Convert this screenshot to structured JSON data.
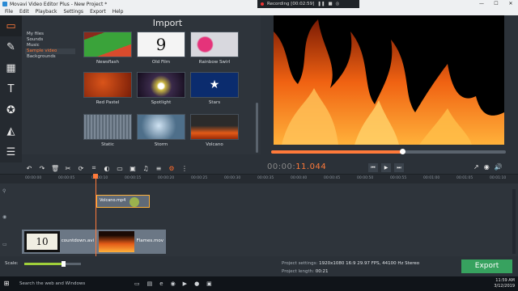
{
  "window": {
    "title": "Movavi Video Editor Plus - New Project *",
    "recording_text": "Recording [00:02:59]",
    "controls": [
      "—",
      "☐",
      "✕"
    ]
  },
  "menu": [
    "File",
    "Edit",
    "Playback",
    "Settings",
    "Export",
    "Help"
  ],
  "import": {
    "title": "Import",
    "categories": [
      "My files",
      "Sounds",
      "Music",
      "Sample video",
      "Backgrounds"
    ],
    "active_category": "Sample video",
    "tiles": [
      {
        "label": "Newsflash",
        "color": "#2f8a32"
      },
      {
        "label": "Old Film",
        "color": "#f3f3f3"
      },
      {
        "label": "Rainbow Swirl",
        "color": "#d8d8de"
      },
      {
        "label": "Red Pastel",
        "color": "#b23b12"
      },
      {
        "label": "Spotlight",
        "color": "#2a1a3a"
      },
      {
        "label": "Stars",
        "color": "#0b2c6e"
      },
      {
        "label": "Static",
        "color": "#6c7a8a"
      },
      {
        "label": "Storm",
        "color": "#4e6f8a"
      },
      {
        "label": "Volcano",
        "color": "#2b2b2b"
      }
    ]
  },
  "preview": {
    "timecode_dim": "00:00:",
    "timecode_hl": "11.044",
    "progress": 0.56
  },
  "timeline": {
    "ticks": [
      "00:00:00",
      "00:00:05",
      "00:00:10",
      "00:00:15",
      "00:00:20",
      "00:00:25",
      "00:00:30",
      "00:00:35",
      "00:00:40",
      "00:00:45",
      "00:00:50",
      "00:00:55",
      "00:01:00",
      "00:01:05",
      "00:01:10"
    ],
    "clip_overlay": "Volcano.mp4",
    "clip_a": "countdown.avi",
    "clip_b": "Flames.mov"
  },
  "bottom": {
    "scale_label": "Scale:",
    "scale_value": 0.68,
    "project_settings_label": "Project settings:",
    "project_settings_value": "1920x1080 16:9 29.97 FPS, 44100 Hz Stereo",
    "project_length_label": "Project length:",
    "project_length_value": "00:21",
    "export_label": "Export"
  },
  "taskbar": {
    "search_placeholder": "Search the web and Windows",
    "time": "11:59 AM",
    "date": "3/12/2019"
  }
}
